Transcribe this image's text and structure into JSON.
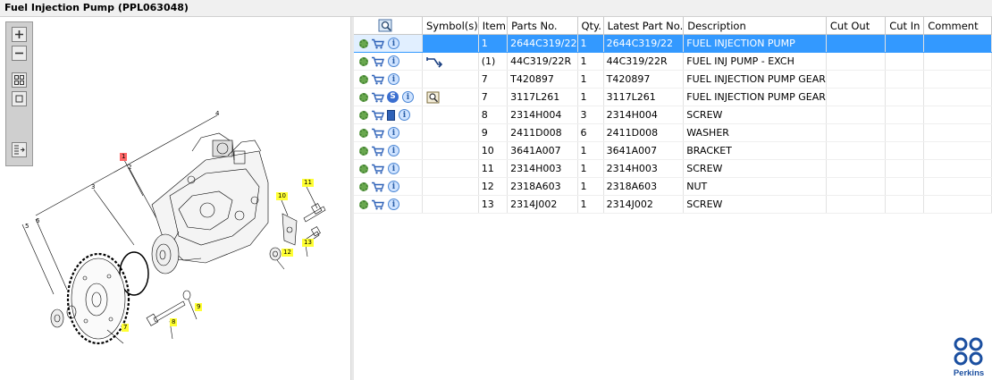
{
  "title": "Fuel Injection Pump (PPL063048)",
  "table": {
    "columns": [
      "",
      "Symbol(s)",
      "Item",
      "Parts No.",
      "Qty.",
      "Latest Part No.",
      "Description",
      "Cut Out",
      "Cut In",
      "Comment"
    ],
    "rows": [
      {
        "item": "1",
        "parts_no": "2644C319/22",
        "qty": "1",
        "latest": "2644C319/22",
        "desc": "FUEL INJECTION PUMP",
        "selected": true,
        "icons": [
          "gear",
          "cart",
          "info"
        ],
        "symbols": []
      },
      {
        "item": "(1)",
        "parts_no": "44C319/22R",
        "qty": "1",
        "latest": "44C319/22R",
        "desc": "FUEL INJ PUMP - EXCH",
        "icons": [
          "gear",
          "cart",
          "info"
        ],
        "symbols": [
          "exchange"
        ]
      },
      {
        "item": "7",
        "parts_no": "T420897",
        "qty": "1",
        "latest": "T420897",
        "desc": "FUEL INJECTION PUMP GEAR",
        "icons": [
          "gear",
          "cart",
          "info"
        ],
        "symbols": []
      },
      {
        "item": "7",
        "parts_no": "3117L261",
        "qty": "1",
        "latest": "3117L261",
        "desc": "FUEL INJECTION PUMP GEAR",
        "icons": [
          "gear",
          "cart",
          "s-badge",
          "info"
        ],
        "symbols": [
          "magnifier"
        ]
      },
      {
        "item": "8",
        "parts_no": "2314H004",
        "qty": "3",
        "latest": "2314H004",
        "desc": "SCREW",
        "icons": [
          "gear",
          "cart",
          "book",
          "info"
        ],
        "symbols": []
      },
      {
        "item": "9",
        "parts_no": "2411D008",
        "qty": "6",
        "latest": "2411D008",
        "desc": "WASHER",
        "icons": [
          "gear",
          "cart",
          "info"
        ],
        "symbols": []
      },
      {
        "item": "10",
        "parts_no": "3641A007",
        "qty": "1",
        "latest": "3641A007",
        "desc": "BRACKET",
        "icons": [
          "gear",
          "cart",
          "info"
        ],
        "symbols": []
      },
      {
        "item": "11",
        "parts_no": "2314H003",
        "qty": "1",
        "latest": "2314H003",
        "desc": "SCREW",
        "icons": [
          "gear",
          "cart",
          "info"
        ],
        "symbols": []
      },
      {
        "item": "12",
        "parts_no": "2318A603",
        "qty": "1",
        "latest": "2318A603",
        "desc": "NUT",
        "icons": [
          "gear",
          "cart",
          "info"
        ],
        "symbols": []
      },
      {
        "item": "13",
        "parts_no": "2314J002",
        "qty": "1",
        "latest": "2314J002",
        "desc": "SCREW",
        "icons": [
          "gear",
          "cart",
          "info"
        ],
        "symbols": []
      }
    ]
  },
  "diagram": {
    "callouts": [
      "1",
      "2",
      "3",
      "4",
      "5",
      "6",
      "7",
      "8",
      "9",
      "10",
      "11",
      "12",
      "13"
    ]
  },
  "logo": {
    "text": "Perkins"
  },
  "colors": {
    "selection": "#3399ff",
    "callout": "#ffff33",
    "callout_selected": "#ff6666",
    "logo": "#1b4fa0"
  }
}
